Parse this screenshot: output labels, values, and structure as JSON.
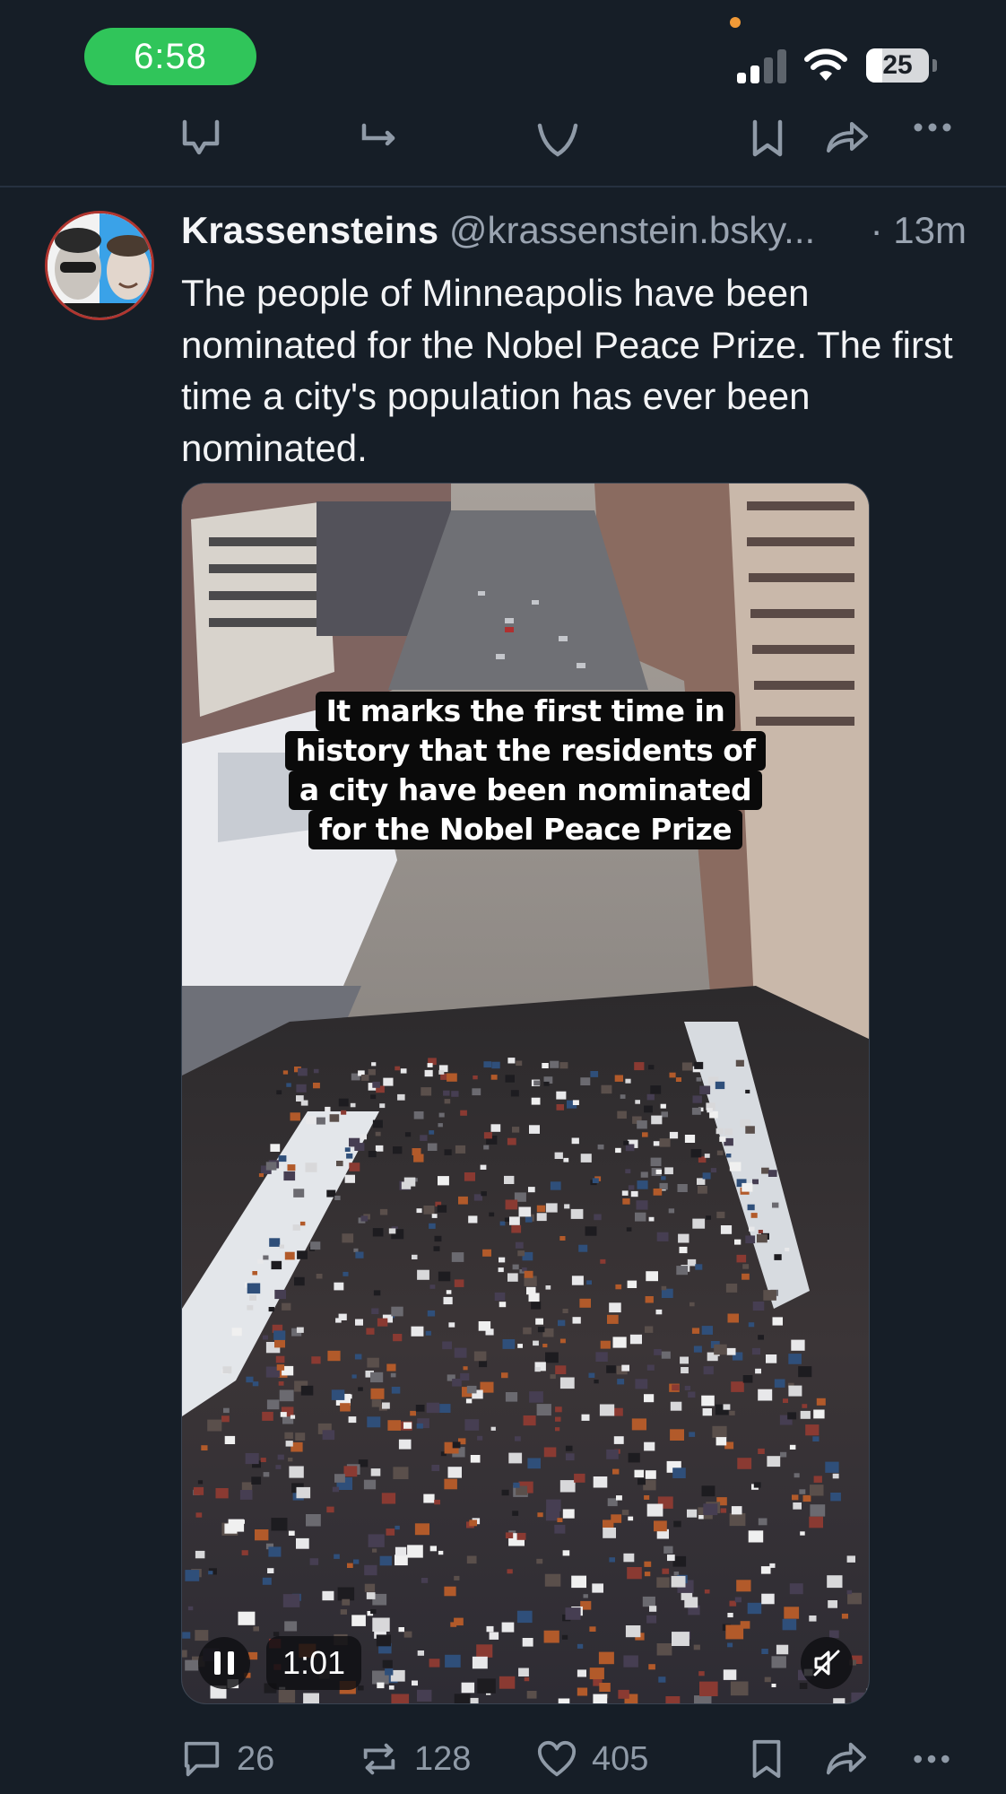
{
  "status_bar": {
    "time": "6:58",
    "battery": "25",
    "battery_level_percent": 25,
    "signal_bars": 2
  },
  "post": {
    "display_name": "Krassensteins",
    "handle": "@krassenstein.bsky...",
    "timestamp": "· 13m",
    "text": "The people of Minneapolis have been nominated for the Nobel Peace Prize. The first time a city's population has ever been nominated.",
    "video": {
      "caption_lines": [
        "It marks the first time in",
        "history that the residents of",
        "a city have been nominated",
        "for the Nobel Peace Prize"
      ],
      "duration": "1:01",
      "muted": true,
      "playing": true
    },
    "actions": {
      "reply_count": "26",
      "repost_count": "128",
      "like_count": "405"
    }
  },
  "icons": {
    "reply": "reply-icon",
    "repost": "repost-icon",
    "like": "heart-icon",
    "bookmark": "bookmark-icon",
    "share": "share-icon",
    "more": "more-icon"
  },
  "colors": {
    "background": "#161e27",
    "time_pill": "#30c55a",
    "text": "#f3f4f6",
    "secondary_text": "#9aa4b1",
    "icon": "#8f9aa7"
  }
}
